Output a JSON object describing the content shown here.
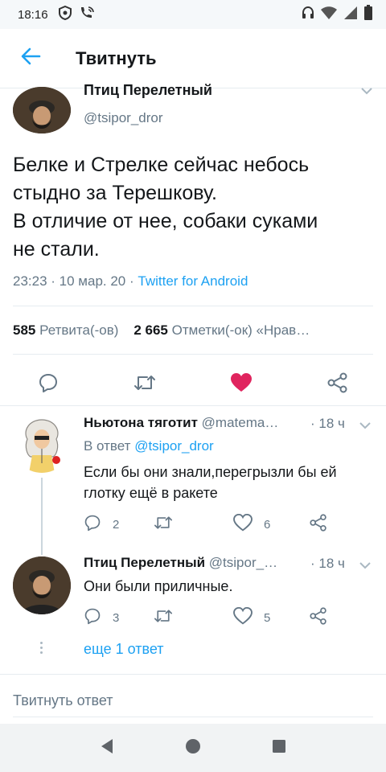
{
  "status": {
    "time": "18:16",
    "icons": [
      "shield-icon",
      "wifi-call-icon",
      "headset-icon",
      "wifi-icon",
      "signal-icon",
      "battery-icon"
    ]
  },
  "header": {
    "title": "Твитнуть"
  },
  "tweet": {
    "author_name": "Птиц Перелетный",
    "author_handle": "@tsipor_dror",
    "text_lines": [
      "Белке и Стрелке сейчас небось",
      "стыдно за Терешкову.",
      "В отличие от нее, собаки суками",
      "не стали."
    ],
    "time": "23:23",
    "date": "10 мар. 20",
    "source": "Twitter for Android",
    "retweets_count": "585",
    "retweets_label": "Ретвита(-ов)",
    "likes_count": "2 665",
    "likes_label": "Отметки(-ок) «Нрав…",
    "colors": {
      "accent": "#1da1f2",
      "like": "#e0245e",
      "muted": "#657786"
    }
  },
  "replies": [
    {
      "author_name": "Ньютона тяготит",
      "author_handle": "@matema…",
      "time": "· 18 ч",
      "in_reply_prefix": "В ответ",
      "in_reply_handle": "@tsipor_dror",
      "text_lines": [
        "Если бы они знали,перегрызли бы ей",
        "глотку ещё в ракете"
      ],
      "replies_count": "2",
      "likes_count": "6"
    },
    {
      "author_name": "Птиц Перелетный",
      "author_handle": "@tsipor_…",
      "time": "· 18 ч",
      "text_lines": [
        "Они были приличные."
      ],
      "replies_count": "3",
      "likes_count": "5"
    }
  ],
  "more_replies": "еще 1 ответ",
  "compose": {
    "placeholder": "Твитнуть ответ"
  }
}
